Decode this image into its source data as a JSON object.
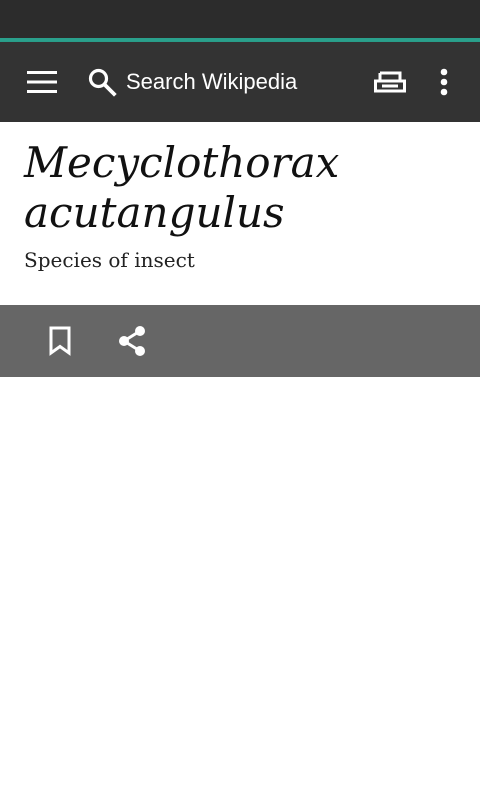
{
  "toolbar": {
    "search_placeholder": "Search Wikipedia",
    "icons": {
      "menu": "hamburger-menu-icon",
      "search": "search-icon",
      "reading_lists": "reading-lists-icon",
      "overflow": "more-vert-icon"
    }
  },
  "article": {
    "title": "Mecyclothorax acutangulus",
    "description": "Species of insect"
  },
  "actions": {
    "icons": {
      "bookmark": "bookmark-icon",
      "share": "share-icon"
    }
  },
  "colors": {
    "status_bar": "#2c2c2c",
    "progress": "#2aa08c",
    "toolbar": "#333333",
    "action_bar": "#666666",
    "background": "#ffffff"
  }
}
